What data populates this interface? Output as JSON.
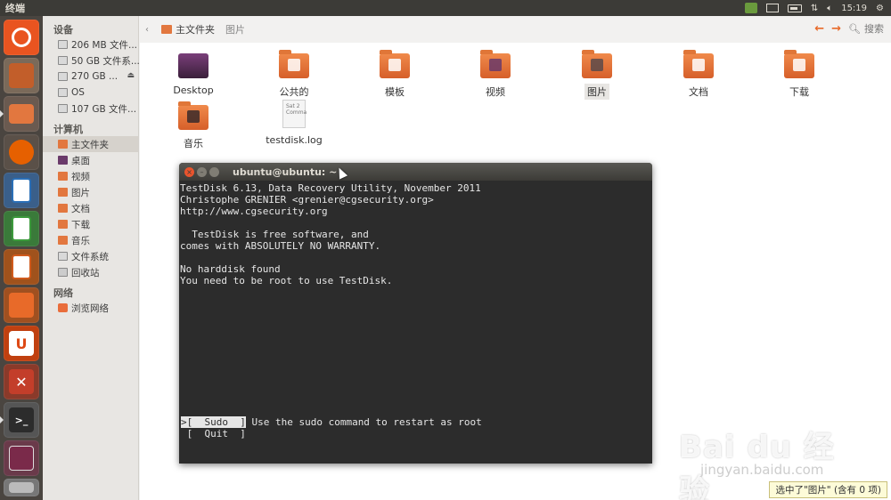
{
  "top_panel": {
    "app_title": "终端",
    "clock": "15:19",
    "indicators": [
      "app-indicator-icon",
      "mail-icon",
      "battery-icon",
      "network-icon",
      "volume-icon",
      "gear-icon"
    ]
  },
  "launcher": {
    "items": [
      {
        "name": "dash-home",
        "color": "#e95420"
      },
      {
        "name": "installer",
        "color": "#c25e2a"
      },
      {
        "name": "files",
        "color": "#e2773f"
      },
      {
        "name": "firefox",
        "color": "#e66000"
      },
      {
        "name": "writer",
        "color": "#2a6fb7"
      },
      {
        "name": "calc",
        "color": "#3c9a3c"
      },
      {
        "name": "impress",
        "color": "#d05a1c"
      },
      {
        "name": "software-center",
        "color": "#e86a29"
      },
      {
        "name": "ubuntu-one",
        "color": "#dd4814"
      },
      {
        "name": "system-settings",
        "color": "#c33e2a"
      },
      {
        "name": "terminal",
        "color": "#2c2c2c"
      },
      {
        "name": "workspace-switcher",
        "color": "#7a2a4a"
      },
      {
        "name": "removable-drive",
        "color": "#9a9a9a"
      }
    ]
  },
  "sidebar": {
    "devices_heading": "设备",
    "devices": [
      "206 MB 文件...",
      "50 GB 文件系...",
      "270 GB ...",
      "OS",
      "107 GB 文件..."
    ],
    "computer_heading": "计算机",
    "computer": [
      "主文件夹",
      "桌面",
      "视频",
      "图片",
      "文档",
      "下载",
      "音乐",
      "文件系统",
      "回收站"
    ],
    "network_heading": "网络",
    "network": [
      "浏览网络"
    ]
  },
  "pathbar": {
    "home": "主文件夹",
    "sub": "图片",
    "search": "搜索"
  },
  "files": [
    {
      "label": "Desktop"
    },
    {
      "label": "公共的"
    },
    {
      "label": "模板"
    },
    {
      "label": "视频"
    },
    {
      "label": "图片"
    },
    {
      "label": "文档"
    },
    {
      "label": "下载"
    },
    {
      "label": "音乐"
    },
    {
      "label": "testdisk.log",
      "doc_text": "Sat 2 Comma"
    }
  ],
  "terminal": {
    "title": "ubuntu@ubuntu: ~",
    "lines": [
      "TestDisk 6.13, Data Recovery Utility, November 2011",
      "Christophe GRENIER <grenier@cgsecurity.org>",
      "http://www.cgsecurity.org",
      "",
      "  TestDisk is free software, and",
      "comes with ABSOLUTELY NO WARRANTY.",
      "",
      "No harddisk found",
      "You need to be root to use TestDisk."
    ],
    "menu_selected": ">[  Sudo  ]",
    "menu_selected_desc": " Use the sudo command to restart as root",
    "menu_other": " [  Quit  ]"
  },
  "status": "选中了\"图片\" (含有 0 项)",
  "watermark": {
    "main": "Bai du 经验",
    "sub": "jingyan.baidu.com"
  }
}
